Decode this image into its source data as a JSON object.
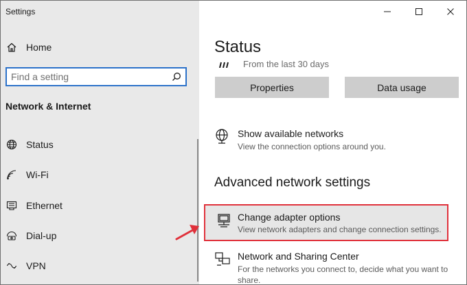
{
  "window": {
    "title": "Settings",
    "controls": {
      "minimize": "—",
      "maximize": "☐",
      "close": "✕"
    }
  },
  "sidebar": {
    "home_label": "Home",
    "search": {
      "placeholder": "Find a setting",
      "value": ""
    },
    "section_title": "Network & Internet",
    "items": [
      {
        "label": "Status",
        "icon": "globe-icon"
      },
      {
        "label": "Wi-Fi",
        "icon": "wifi-icon"
      },
      {
        "label": "Ethernet",
        "icon": "ethernet-icon"
      },
      {
        "label": "Dial-up",
        "icon": "dialup-icon"
      },
      {
        "label": "VPN",
        "icon": "vpn-icon"
      }
    ]
  },
  "main": {
    "title": "Status",
    "usage_text": "From the last 30 days",
    "buttons": {
      "properties": "Properties",
      "data_usage": "Data usage"
    },
    "show_networks": {
      "title": "Show available networks",
      "desc": "View the connection options around you."
    },
    "advanced_heading": "Advanced network settings",
    "change_adapter": {
      "title": "Change adapter options",
      "desc": "View network adapters and change connection settings."
    },
    "sharing_center": {
      "title": "Network and Sharing Center",
      "desc": "For the networks you connect to, decide what you want to share."
    }
  },
  "colors": {
    "sidebar_bg": "#e9e9e9",
    "accent": "#2b71c9",
    "highlight": "#e0303a",
    "button_bg": "#cdcdcd"
  }
}
